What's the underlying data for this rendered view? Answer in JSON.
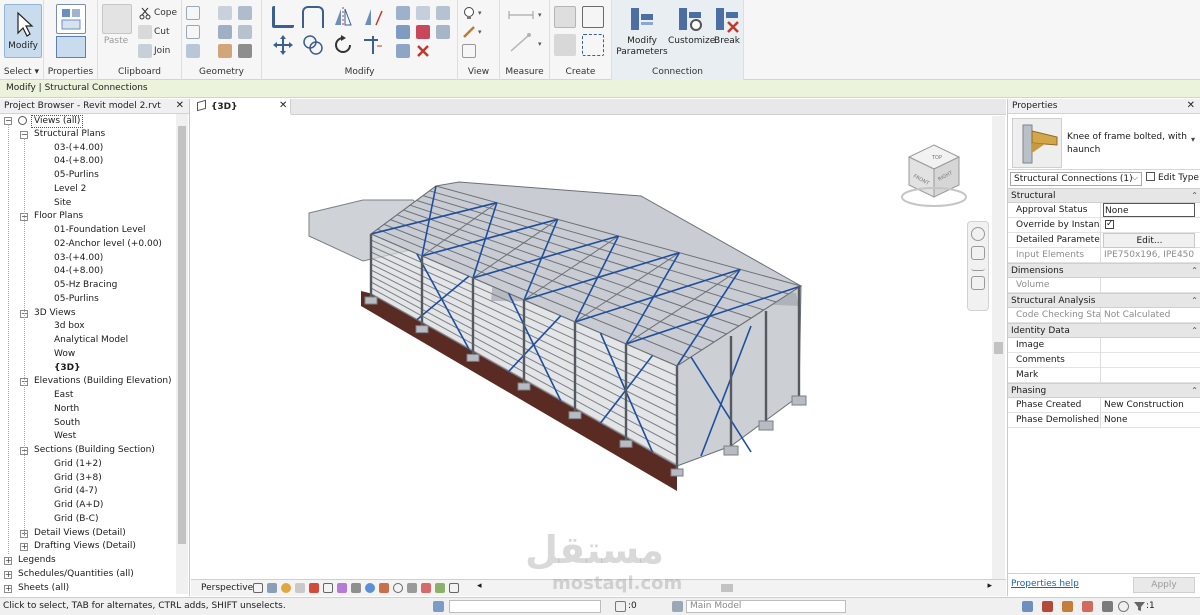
{
  "ribbon": {
    "select": {
      "button": "Modify",
      "label": "Select"
    },
    "properties": {
      "label": "Properties"
    },
    "clipboard": {
      "paste": "Paste",
      "cope": "Cope",
      "cut": "Cut",
      "join": "Join",
      "label": "Clipboard"
    },
    "geometry": {
      "label": "Geometry"
    },
    "modify": {
      "label": "Modify"
    },
    "view": {
      "label": "View"
    },
    "measure": {
      "label": "Measure"
    },
    "create": {
      "label": "Create"
    },
    "connection": {
      "label": "Connection",
      "modify_parameters": "Modify Parameters",
      "customize": "Customize",
      "break": "Break"
    }
  },
  "context_bar": {
    "text": "Modify | Structural Connections"
  },
  "browser": {
    "title": "Project Browser - Revit model 2.rvt",
    "items": [
      {
        "label": "Views (all)",
        "level": 0,
        "toggle": "-"
      },
      {
        "label": "Structural Plans",
        "level": 1,
        "toggle": "-"
      },
      {
        "label": "03-(+4.00)",
        "level": 2
      },
      {
        "label": "04-(+8.00)",
        "level": 2
      },
      {
        "label": "05-Purlins",
        "level": 2
      },
      {
        "label": "Level 2",
        "level": 2
      },
      {
        "label": "Site",
        "level": 2
      },
      {
        "label": "Floor Plans",
        "level": 1,
        "toggle": "-"
      },
      {
        "label": "01-Foundation Level",
        "level": 2
      },
      {
        "label": "02-Anchor level (+0.00)",
        "level": 2
      },
      {
        "label": "03-(+4.00)",
        "level": 2
      },
      {
        "label": "04-(+8.00)",
        "level": 2
      },
      {
        "label": "05-Hz Bracing",
        "level": 2
      },
      {
        "label": "05-Purlins",
        "level": 2
      },
      {
        "label": "3D Views",
        "level": 1,
        "toggle": "-"
      },
      {
        "label": "3d box",
        "level": 2
      },
      {
        "label": "Analytical Model",
        "level": 2
      },
      {
        "label": "Wow",
        "level": 2
      },
      {
        "label": "{3D}",
        "level": 2,
        "active": true
      },
      {
        "label": "Elevations (Building Elevation)",
        "level": 1,
        "toggle": "-"
      },
      {
        "label": "East",
        "level": 2
      },
      {
        "label": "North",
        "level": 2
      },
      {
        "label": "South",
        "level": 2
      },
      {
        "label": "West",
        "level": 2
      },
      {
        "label": "Sections (Building Section)",
        "level": 1,
        "toggle": "-"
      },
      {
        "label": "Grid (1+2)",
        "level": 2
      },
      {
        "label": "Grid (3+8)",
        "level": 2
      },
      {
        "label": "Grid (4-7)",
        "level": 2
      },
      {
        "label": "Grid (A+D)",
        "level": 2
      },
      {
        "label": "Grid (B-C)",
        "level": 2
      },
      {
        "label": "Detail Views (Detail)",
        "level": 1,
        "toggle": "+"
      },
      {
        "label": "Drafting Views (Detail)",
        "level": 1,
        "toggle": "+"
      },
      {
        "label": "Legends",
        "level": 0,
        "toggle": "+"
      },
      {
        "label": "Schedules/Quantities (all)",
        "level": 0,
        "toggle": "+"
      },
      {
        "label": "Sheets (all)",
        "level": 0,
        "toggle": "+"
      }
    ]
  },
  "viewport": {
    "tab": "{3D}",
    "viewcube": {
      "top": "TOP",
      "front": "FRONT",
      "right": "RIGHT"
    },
    "view_controls": {
      "mode": "Perspective"
    },
    "colors": {
      "frame_grey": "#8a8f96",
      "bracing_blue": "#1f4e9e",
      "wall_brown": "#5a2b22",
      "footing": "#b8bcc2"
    }
  },
  "properties": {
    "title": "Properties",
    "type_name": "Knee of frame bolted, with haunch",
    "filter": "Structural Connections (1)",
    "edit_type": "Edit Type",
    "groups": [
      {
        "name": "Structural",
        "rows": [
          {
            "name": "Approval Status",
            "value": "None",
            "kind": "input"
          },
          {
            "name": "Override by Instance",
            "value": "",
            "kind": "check"
          },
          {
            "name": "Detailed Parameters",
            "value": "Edit...",
            "kind": "button"
          },
          {
            "name": "Input Elements",
            "value": "IPE750x196, IPE450",
            "kind": "dim"
          }
        ]
      },
      {
        "name": "Dimensions",
        "rows": [
          {
            "name": "Volume",
            "value": "",
            "kind": "dim"
          }
        ]
      },
      {
        "name": "Structural Analysis",
        "rows": [
          {
            "name": "Code Checking Sta...",
            "value": "Not Calculated",
            "kind": "dim"
          }
        ]
      },
      {
        "name": "Identity Data",
        "rows": [
          {
            "name": "Image",
            "value": "",
            "kind": "text"
          },
          {
            "name": "Comments",
            "value": "",
            "kind": "text"
          },
          {
            "name": "Mark",
            "value": "",
            "kind": "text"
          }
        ]
      },
      {
        "name": "Phasing",
        "rows": [
          {
            "name": "Phase Created",
            "value": "New Construction",
            "kind": "text"
          },
          {
            "name": "Phase Demolished",
            "value": "None",
            "kind": "text"
          }
        ]
      }
    ],
    "help": "Properties help",
    "apply": "Apply"
  },
  "status": {
    "text": "Click to select, TAB for alternates, CTRL adds, SHIFT unselects.",
    "selection_count": ":0",
    "model": "Main Model",
    "filter_count": ":1"
  },
  "watermark": {
    "arabic": "مستقل",
    "latin": "mostaql.com"
  }
}
